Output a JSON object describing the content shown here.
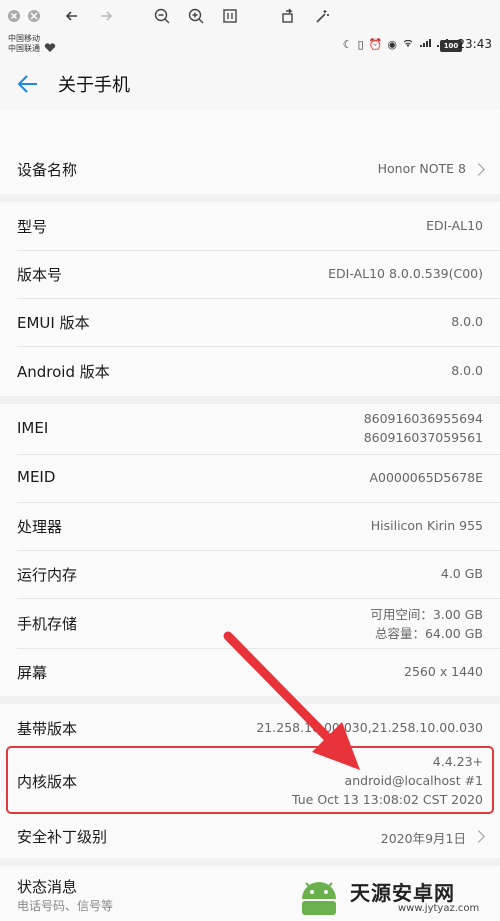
{
  "status": {
    "carrier1": "中国移动",
    "carrier2": "中国联通",
    "battery": "100",
    "time": "23:43"
  },
  "header": {
    "title": "关于手机"
  },
  "rows": {
    "device_name": {
      "label": "设备名称",
      "value": "Honor NOTE 8"
    },
    "model": {
      "label": "型号",
      "value": "EDI-AL10"
    },
    "build": {
      "label": "版本号",
      "value": "EDI-AL10 8.0.0.539(C00)"
    },
    "emui": {
      "label": "EMUI 版本",
      "value": "8.0.0"
    },
    "android": {
      "label": "Android 版本",
      "value": "8.0.0"
    },
    "imei": {
      "label": "IMEI",
      "value1": "860916036955694",
      "value2": "860916037059561"
    },
    "meid": {
      "label": "MEID",
      "value": "A0000065D5678E"
    },
    "processor": {
      "label": "处理器",
      "value": "Hisilicon Kirin 955"
    },
    "ram": {
      "label": "运行内存",
      "value": "4.0 GB"
    },
    "storage": {
      "label": "手机存储",
      "value1": "可用空间：3.00  GB",
      "value2": "总容量：64.00  GB"
    },
    "screen": {
      "label": "屏幕",
      "value": "2560 x 1440"
    },
    "baseband": {
      "label": "基带版本",
      "value": "21.258.10.00.030,21.258.10.00.030"
    },
    "kernel": {
      "label": "内核版本",
      "value1": "4.4.23+",
      "value2": "android@localhost #1",
      "value3": "Tue Oct 13 13:08:02 CST 2020"
    },
    "security_patch": {
      "label": "安全补丁级别",
      "value": "2020年9月1日"
    },
    "status_info": {
      "label": "状态消息",
      "sub": "电话号码、信号等"
    }
  },
  "watermark": {
    "name": "天源安卓网",
    "url": "www.jytyaz.com"
  },
  "colors": {
    "accent": "#1e88e5",
    "highlight": "#e23a3a"
  }
}
